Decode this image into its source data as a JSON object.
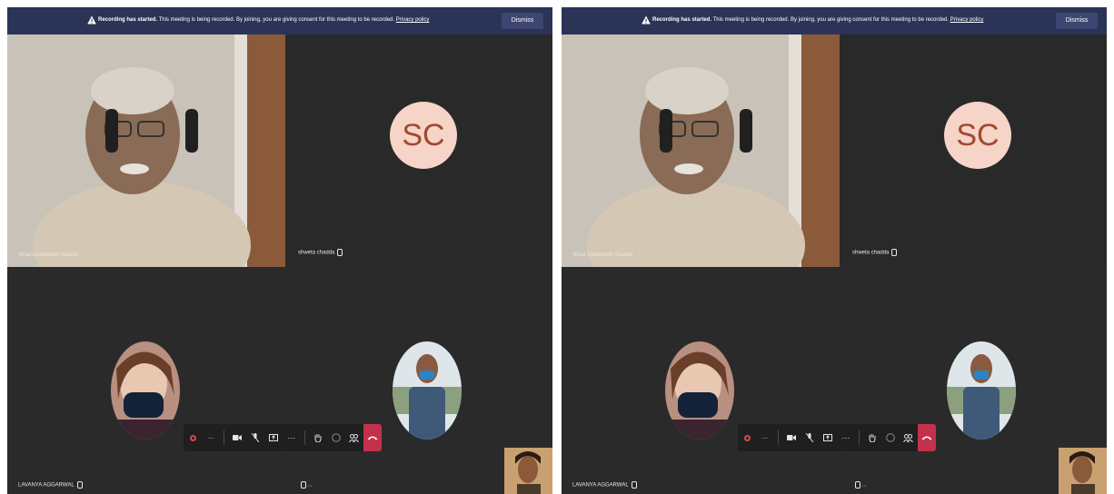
{
  "banner": {
    "title": "Recording has started.",
    "message": "This meeting is being recorded. By joining, you are giving consent for this meeting to be recorded.",
    "privacy_link": "Privacy policy",
    "dismiss_label": "Dismiss"
  },
  "participants": {
    "p1_name": "Nirad Deshmukh (Guest)",
    "p2_name": "shweta chadda",
    "p2_initials": "SC",
    "p3_name": "LAVANYA AGGARWAL",
    "p4_name": "..."
  },
  "controls": {
    "timer": "—",
    "more_label": "···"
  },
  "colors": {
    "banner_bg": "#2b3457",
    "stage_bg": "#292929",
    "leave_red": "#c4314b",
    "avatar_bg": "#f6d4c8",
    "avatar_text": "#a04a32"
  }
}
